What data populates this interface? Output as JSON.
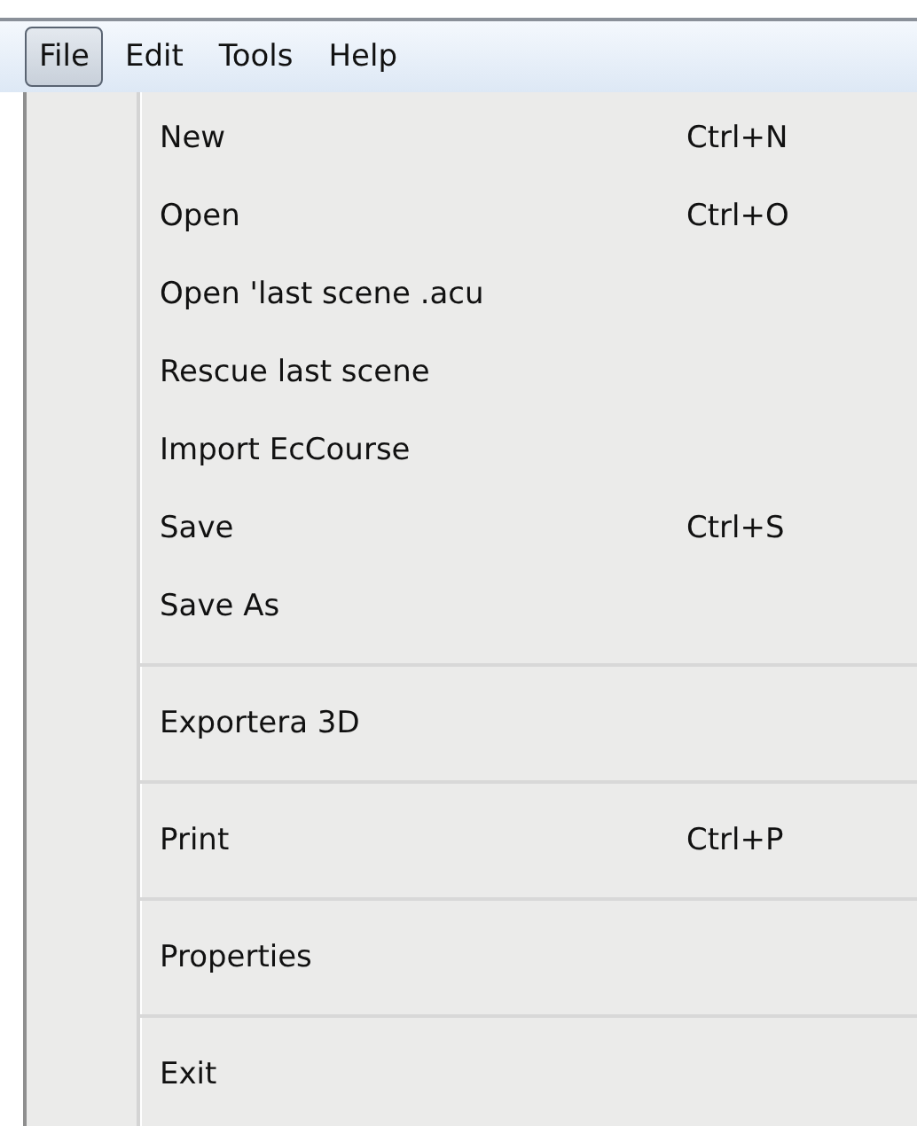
{
  "menu_bar": [
    {
      "label": "File",
      "selected": true
    },
    {
      "label": "Edit",
      "selected": false
    },
    {
      "label": "Tools",
      "selected": false
    },
    {
      "label": "Help",
      "selected": false
    }
  ],
  "file_menu": [
    {
      "kind": "item",
      "label": "New",
      "shortcut": "Ctrl+N"
    },
    {
      "kind": "item",
      "label": "Open",
      "shortcut": "Ctrl+O"
    },
    {
      "kind": "item",
      "label": "Open 'last scene .acu"
    },
    {
      "kind": "item",
      "label": "Rescue last scene"
    },
    {
      "kind": "item",
      "label": "Import EcCourse"
    },
    {
      "kind": "item",
      "label": "Save",
      "shortcut": "Ctrl+S"
    },
    {
      "kind": "item",
      "label": "Save As"
    },
    {
      "kind": "separator"
    },
    {
      "kind": "item",
      "label": "Exportera 3D"
    },
    {
      "kind": "separator"
    },
    {
      "kind": "item",
      "label": "Print",
      "shortcut": "Ctrl+P"
    },
    {
      "kind": "separator"
    },
    {
      "kind": "item",
      "label": "Properties"
    },
    {
      "kind": "separator"
    },
    {
      "kind": "item",
      "label": "Exit"
    }
  ]
}
